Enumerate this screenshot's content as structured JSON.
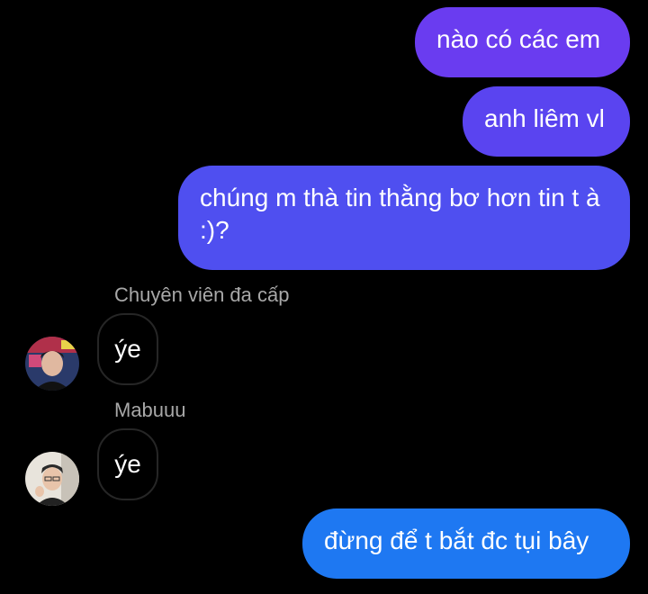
{
  "messages": {
    "m1": "nào có các em",
    "m2": "anh liêm vl",
    "m3": "chúng m thà tin thằng bơ hơn tin t à :)?",
    "m4_sender": "Chuyên viên đa cấp",
    "m4": "ýe",
    "m5_sender": "Mabuuu",
    "m5": "ýe",
    "m6": "đừng để t bắt đc tụi bây"
  },
  "colors": {
    "background": "#000000",
    "outgoing_top": "#6a3cf0",
    "outgoing_mid": "#4f4ff0",
    "outgoing_bottom": "#1e78f2",
    "incoming_border": "#262626",
    "sender_text": "#a8a8a8"
  },
  "icons": {
    "avatar1": "user-avatar-photo",
    "avatar2": "user-avatar-photo"
  }
}
